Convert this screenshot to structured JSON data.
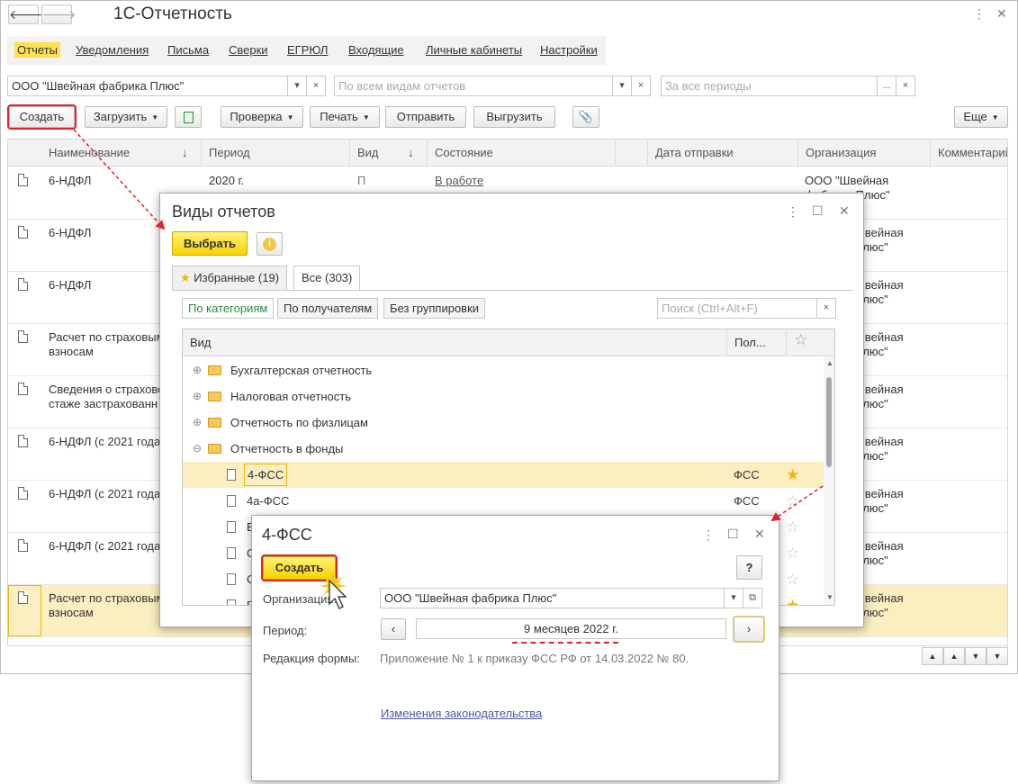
{
  "app": {
    "title": "1С-Отчетность"
  },
  "tabs": [
    "Отчеты",
    "Уведомления",
    "Письма",
    "Сверки",
    "ЕГРЮЛ",
    "Входящие",
    "Личные кабинеты",
    "Настройки"
  ],
  "filters": {
    "org": "ООО \"Швейная фабрика Плюс\"",
    "kinds_placeholder": "По всем видам отчетов",
    "period_placeholder": "За все периоды",
    "dots": "...",
    "clear": "×"
  },
  "toolbar": {
    "create": "Создать",
    "load": "Загрузить",
    "check": "Проверка",
    "print": "Печать",
    "send": "Отправить",
    "export": "Выгрузить",
    "more": "Еще"
  },
  "table": {
    "columns": [
      "Наименование",
      "Период",
      "Вид",
      "Состояние",
      "Дата отправки",
      "Организация",
      "Комментарий"
    ],
    "rows": [
      {
        "name": "6-НДФЛ",
        "period": "2020 г.",
        "kind": "П",
        "state": "В работе",
        "org": "ООО \"Швейная\nфабрика Плюс\""
      },
      {
        "name": "6-НДФЛ",
        "period": "",
        "kind": "",
        "state": "",
        "org": "Швейная\nПлюс\""
      },
      {
        "name": "6-НДФЛ",
        "period": "",
        "kind": "",
        "state": "",
        "org": "Швейная\nПлюс\""
      },
      {
        "name": "Расчет по страховым\nвзносам",
        "period": "",
        "kind": "",
        "state": "",
        "org": "Швейная\nПлюс\""
      },
      {
        "name": "Сведения о страхово\nстаже застрахованн",
        "period": "",
        "kind": "",
        "state": "",
        "org": "Швейная\nПлюс\""
      },
      {
        "name": "6-НДФЛ (с 2021 года",
        "period": "",
        "kind": "",
        "state": "",
        "org": "Швейная\nПлюс\""
      },
      {
        "name": "6-НДФЛ (с 2021 года",
        "period": "",
        "kind": "",
        "state": "",
        "org": "Швейная\nПлюс\""
      },
      {
        "name": "6-НДФЛ (с 2021 года",
        "period": "",
        "kind": "",
        "state": "",
        "org": "Швейная\nПлюс\""
      },
      {
        "name": "Расчет по страховым\nвзносам",
        "period": "",
        "kind": "",
        "state": "",
        "org": "Швейная\nПлюс\""
      }
    ]
  },
  "dialog_kinds": {
    "title": "Виды отчетов",
    "select": "Выбрать",
    "tab_fav": "Избранные (19)",
    "tab_all": "Все (303)",
    "grp_cat": "По категориям",
    "grp_rcp": "По получателям",
    "grp_none": "Без группировки",
    "search_placeholder": "Поиск (Ctrl+Alt+F)",
    "col_kind": "Вид",
    "col_rcp": "Пол...",
    "tree": [
      {
        "label": "Бухгалтерская отчетность",
        "type": "folder",
        "sign": "⊕"
      },
      {
        "label": "Налоговая отчетность",
        "type": "folder",
        "sign": "⊕"
      },
      {
        "label": "Отчетность по физлицам",
        "type": "folder",
        "sign": "⊕"
      },
      {
        "label": "Отчетность в фонды",
        "type": "folder",
        "sign": "⊖"
      },
      {
        "label": "4-ФСС",
        "type": "doc",
        "rcp": "ФСС",
        "fav": true
      },
      {
        "label": "4а-ФСС",
        "type": "doc",
        "rcp": "ФСС",
        "fav": false
      },
      {
        "label": "Е",
        "type": "doc",
        "rcp": "",
        "fav": false
      },
      {
        "label": "С",
        "type": "doc",
        "rcp": "",
        "fav": false
      },
      {
        "label": "С",
        "type": "doc",
        "rcp": "",
        "fav": false
      },
      {
        "label": "Г",
        "type": "doc",
        "rcp": "",
        "fav": true
      }
    ]
  },
  "dialog_form": {
    "title": "4-ФСС",
    "create": "Создать",
    "help": "?",
    "org_label": "Организация:",
    "org_value": "ООО \"Швейная фабрика Плюс\"",
    "period_label": "Период:",
    "period_value": "9 месяцев 2022 г.",
    "edition_label": "Редакция формы:",
    "edition_value": "Приложение № 1 к приказу ФСС РФ от 14.03.2022 № 80.",
    "law_link": "Изменения законодательства"
  },
  "colors": {
    "accent_yellow": "#f5d300",
    "highlight_red": "#e0242b",
    "selected_row": "#fbeec0"
  }
}
